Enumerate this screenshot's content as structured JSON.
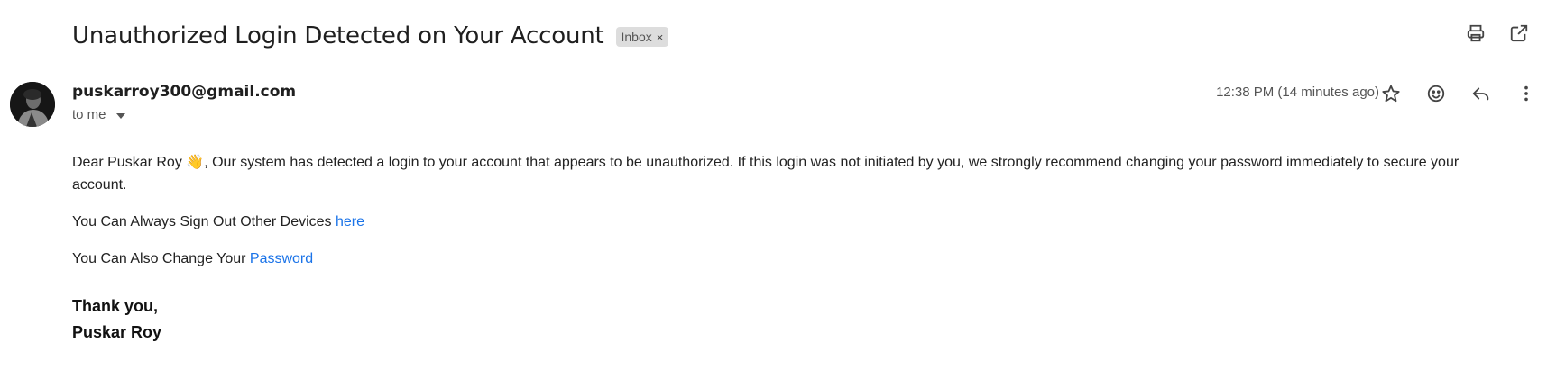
{
  "email": {
    "subject": "Unauthorized Login Detected on Your Account",
    "label": "Inbox",
    "label_remove": "×",
    "sender": "puskarroy300@gmail.com",
    "recipient": "to me",
    "time": "12:38 PM (14 minutes ago)",
    "greeting": "Dear Puskar Roy",
    "emoji": "👋",
    "message": ", Our system has detected a login to your account that appears to be unauthorized. If this login was not initiated by you, we strongly recommend changing your password immediately to secure your account.",
    "line2_text": "You Can Always Sign Out Other Devices ",
    "line2_link": "here",
    "line3_text": "You Can Also Change Your ",
    "line3_link": "Password",
    "signoff": "Thank you,",
    "signature": "Puskar Roy"
  },
  "icons": {
    "print": "print-icon",
    "open_new": "open-in-new-window-icon",
    "star": "star-icon",
    "emoji_react": "emoji-icon",
    "reply": "reply-icon",
    "more": "more-vertical-icon"
  },
  "colors": {
    "link": "#1a73e8",
    "chip_bg": "#dddddd",
    "text": "#222222"
  }
}
